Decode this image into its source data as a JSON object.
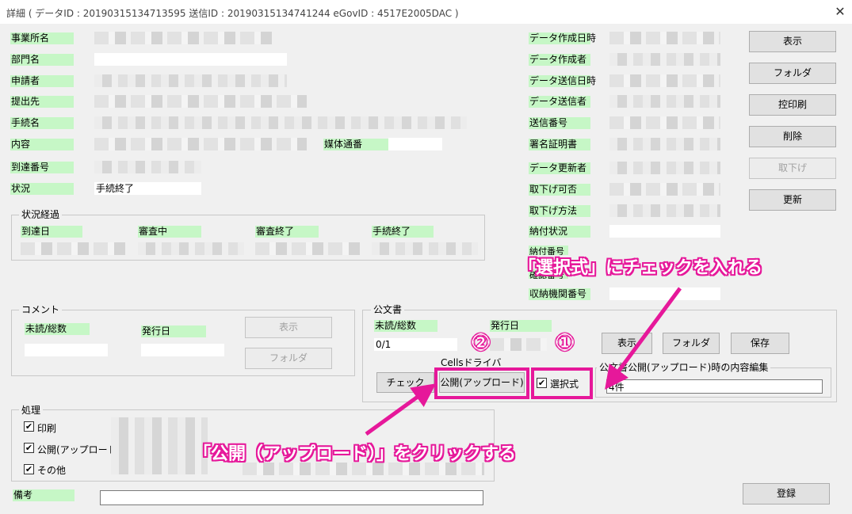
{
  "window": {
    "title": "詳細 ( データID : 20190315134713595 送信ID : 20190315134741244 eGovID : 4517E2005DAC )",
    "close_glyph": "✕"
  },
  "left_fields": {
    "office": "事業所名",
    "department": "部門名",
    "applicant": "申請者",
    "submit_to": "提出先",
    "procedure": "手続名",
    "content": "内容",
    "media_no": "媒体通番",
    "arrival_no": "到達番号",
    "status": "状況",
    "status_value": "手続終了"
  },
  "right_fields": {
    "created_at": "データ作成日時",
    "created_by": "データ作成者",
    "sent_at": "データ送信日時",
    "sent_by": "データ送信者",
    "send_no": "送信番号",
    "cert": "署名証明書",
    "updated_by": "データ更新者",
    "withdrawable": "取下げ可否",
    "withdraw_method": "取下げ方法",
    "payment_status": "納付状況",
    "payment_no_partial": "納付番号",
    "confirm_no_partial": "確認番号",
    "agency_no": "収納機関番号"
  },
  "buttons": {
    "show": "表示",
    "folder": "フォルダ",
    "copy_print": "控印刷",
    "delete": "削除",
    "withdraw": "取下げ",
    "update": "更新",
    "register": "登録"
  },
  "progress": {
    "title": "状況経過",
    "cols": [
      "到達日",
      "審査中",
      "審査終了",
      "手続終了"
    ]
  },
  "comment": {
    "title": "コメント",
    "unread_total": "未読/総数",
    "issue_date": "発行日",
    "show": "表示",
    "folder": "フォルダ"
  },
  "official": {
    "title": "公文書",
    "unread_total": "未読/総数",
    "count_value": "0/1",
    "issue_date": "発行日",
    "show": "表示",
    "folder": "フォルダ",
    "save": "保存",
    "cells_label": "Cellsドライバ",
    "check": "チェック",
    "publish_upload": "公開(アップロード)",
    "selective": "選択式",
    "edit_title": "公文書公開(アップロード)時の内容編集",
    "edit_value": "4件"
  },
  "process": {
    "title": "処理",
    "items": [
      "印刷",
      "公開(アップロード)",
      "その他"
    ],
    "check_glyph": "✔"
  },
  "remarks": "備考",
  "annotations": {
    "num1": "①",
    "num2": "②",
    "text1": "「選択式」にチェックを入れる",
    "text2": "「公開（アップロード）」をクリックする"
  },
  "colors": {
    "label_bg": "#c6f7c6",
    "annotation": "#e6189a"
  }
}
